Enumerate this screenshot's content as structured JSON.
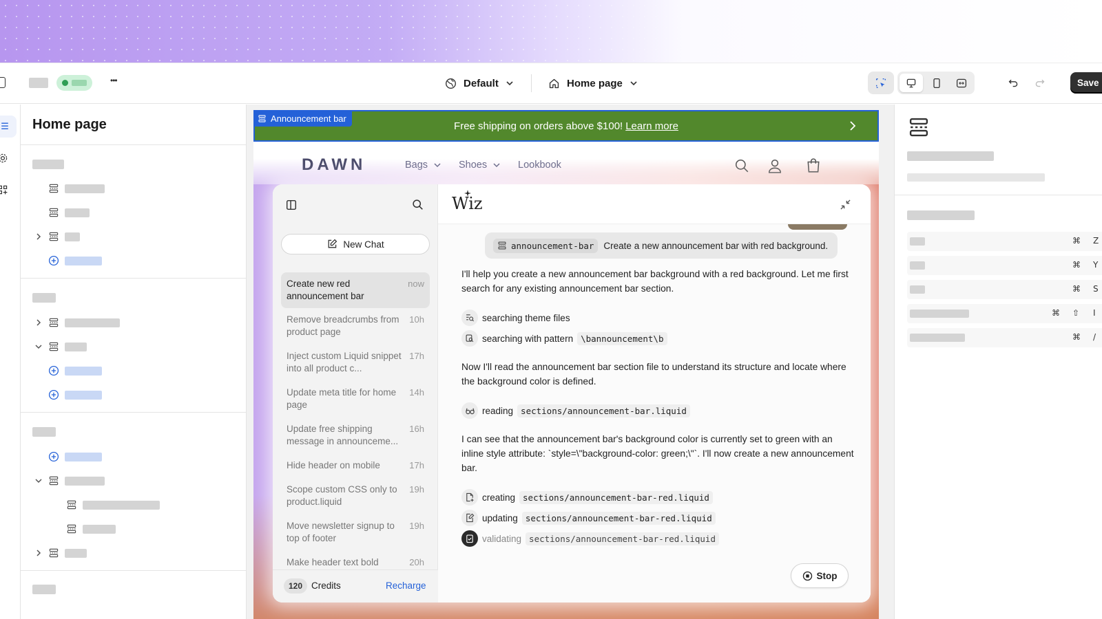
{
  "topbar": {
    "theme_label": "Default",
    "page_label": "Home page",
    "save_label": "Save",
    "more_label": "•••"
  },
  "left_panel": {
    "title": "Home page"
  },
  "announcement_bar": {
    "tag_label": "Announcement bar",
    "text": "Free shipping on orders above $100!",
    "link": "Learn more",
    "color": "#52882c"
  },
  "store": {
    "logo": "DAWN",
    "nav": [
      {
        "label": "Bags"
      },
      {
        "label": "Shoes"
      },
      {
        "label": "Lookbook"
      }
    ]
  },
  "wiz": {
    "title": "Wiz",
    "new_chat": "New Chat",
    "chats": [
      {
        "title": "Create new red announcement bar",
        "time": "now"
      },
      {
        "title": "Remove breadcrumbs from product page",
        "time": "10h"
      },
      {
        "title": "Inject custom Liquid snippet into all product c...",
        "time": "17h"
      },
      {
        "title": "Update meta title for home page",
        "time": "14h"
      },
      {
        "title": "Update free shipping message in announceme...",
        "time": "16h"
      },
      {
        "title": "Hide header on mobile",
        "time": "17h"
      },
      {
        "title": "Scope custom CSS only to product.liquid",
        "time": "19h"
      },
      {
        "title": "Move newsletter signup to top of footer",
        "time": "19h"
      },
      {
        "title": "Make header text bold",
        "time": "20h"
      }
    ],
    "credits_count": "120",
    "credits_label": "Credits",
    "recharge": "Recharge",
    "user_message": {
      "chip": "announcement-bar",
      "text": "Create a new announcement bar with red background."
    },
    "msg1": "I'll help you create a new announcement bar background with a red background. Let me first search for any existing announcement bar section.",
    "step_search_files": "searching theme files",
    "step_search_pattern": "searching with pattern",
    "pattern_code": "\\bannouncement\\b",
    "msg2": "Now I'll read the announcement bar section file to understand its structure and locate where the background color is defined.",
    "step_reading": "reading",
    "reading_file": "sections/announcement-bar.liquid",
    "msg3": "I can see that the announcement bar's background color is currently set to green with an inline style attribute: `style=\\\"background-color: green;\\\"`. I'll now create a new announcement bar.",
    "step_creating": "creating",
    "step_updating": "updating",
    "step_validating": "validating",
    "new_file": "sections/announcement-bar-red.liquid",
    "stop": "Stop"
  },
  "shortcuts": [
    {
      "keys": [
        "⌘",
        "Z"
      ]
    },
    {
      "keys": [
        "⌘",
        "Y"
      ]
    },
    {
      "keys": [
        "⌘",
        "S"
      ]
    },
    {
      "keys": [
        "⌘",
        "⇧",
        "I"
      ]
    },
    {
      "keys": [
        "⌘",
        "/"
      ]
    }
  ]
}
